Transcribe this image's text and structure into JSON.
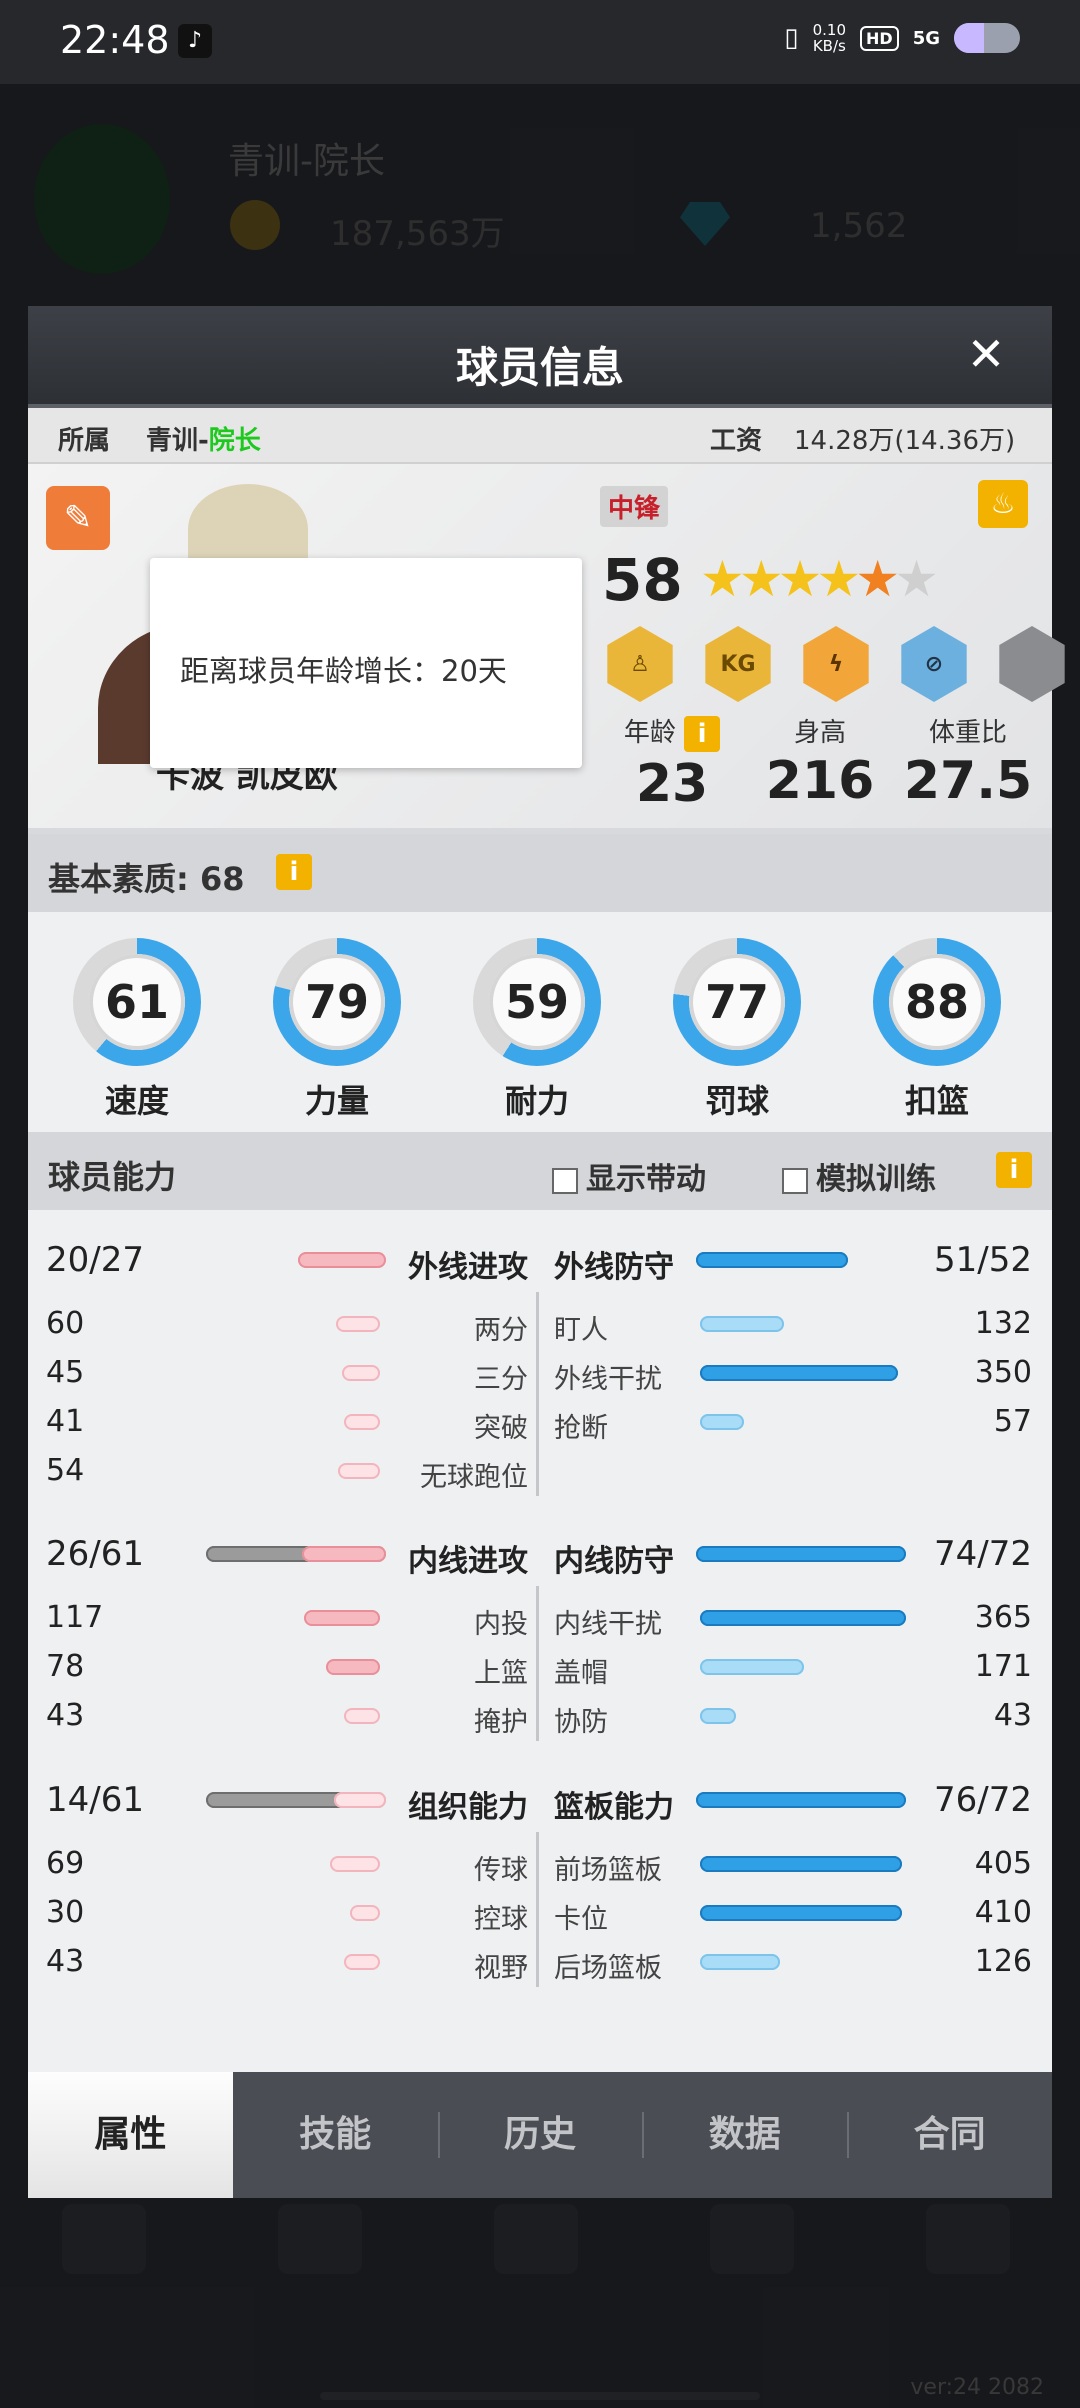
{
  "status_bar": {
    "time": "22:48",
    "net_speed_value": "0.10",
    "net_speed_unit": "KB/s",
    "hd": "HD",
    "signal": "5G",
    "battery_level": 0.45
  },
  "background": {
    "team_name": "青训-院长",
    "coins": "187,563万",
    "gems": "1,562",
    "version": "ver:24 2082"
  },
  "dialog": {
    "title": "球员信息",
    "close_glyph": "✕",
    "team_label": "所属",
    "team_prefix": "青训-",
    "team_role": "院长",
    "salary_label": "工资",
    "salary_value": "14.28万(14.36万)",
    "player": {
      "name": "卡波 凯皮欧",
      "position": "中锋",
      "overall": "58",
      "stars_display": {
        "gold": "★★★★",
        "orange": "★",
        "empty": "★"
      },
      "badges": [
        "player-badge",
        "KG",
        "lightning-badge",
        "defense-badge",
        "empty-badge"
      ],
      "badge_kg_text": "KG",
      "age_label": "年龄",
      "age": "23",
      "height_label": "身高",
      "height": "216",
      "weight_label": "体重比",
      "weight": "27.5",
      "tooltip": "距离球员年龄增长：20天",
      "info_glyph": "i"
    },
    "basic_quality": {
      "title": "基本素质: 68",
      "stats": [
        {
          "label": "速度",
          "value": "61",
          "fill": 0.61
        },
        {
          "label": "力量",
          "value": "79",
          "fill": 0.79
        },
        {
          "label": "耐力",
          "value": "59",
          "fill": 0.59
        },
        {
          "label": "罚球",
          "value": "77",
          "fill": 0.77
        },
        {
          "label": "扣篮",
          "value": "88",
          "fill": 0.88
        }
      ]
    },
    "ability": {
      "title": "球员能力",
      "show_drive": "显示带动",
      "simulate_training": "模拟训练",
      "groups": [
        {
          "left_total": "20/27",
          "left_name": "外线进攻",
          "right_name": "外线防守",
          "right_total": "51/52",
          "rows": [
            {
              "lv": "60",
              "ln": "两分",
              "rn": "盯人",
              "rv": "132"
            },
            {
              "lv": "45",
              "ln": "三分",
              "rn": "外线干扰",
              "rv": "350"
            },
            {
              "lv": "41",
              "ln": "突破",
              "rn": "抢断",
              "rv": "57"
            },
            {
              "lv": "54",
              "ln": "无球跑位",
              "rn": "",
              "rv": ""
            }
          ]
        },
        {
          "left_total": "26/61",
          "left_name": "内线进攻",
          "right_name": "内线防守",
          "right_total": "74/72",
          "rows": [
            {
              "lv": "117",
              "ln": "内投",
              "rn": "内线干扰",
              "rv": "365"
            },
            {
              "lv": "78",
              "ln": "上篮",
              "rn": "盖帽",
              "rv": "171"
            },
            {
              "lv": "43",
              "ln": "掩护",
              "rn": "协防",
              "rv": "43"
            }
          ]
        },
        {
          "left_total": "14/61",
          "left_name": "组织能力",
          "right_name": "篮板能力",
          "right_total": "76/72",
          "rows": [
            {
              "lv": "69",
              "ln": "传球",
              "rn": "前场篮板",
              "rv": "405"
            },
            {
              "lv": "30",
              "ln": "控球",
              "rn": "卡位",
              "rv": "410"
            },
            {
              "lv": "43",
              "ln": "视野",
              "rn": "后场篮板",
              "rv": "126"
            }
          ]
        }
      ]
    },
    "tabs": [
      "属性",
      "技能",
      "历史",
      "数据",
      "合同"
    ],
    "active_tab": 0
  },
  "colors": {
    "accent_yellow": "#f3b100",
    "edit_orange": "#f07c3a",
    "position_red": "#c8202a",
    "role_green": "#1ec91e",
    "ring_blue": "#3ba6ea",
    "bar_blue": "#2f9fe6",
    "bar_pink": "#f6b9c0"
  }
}
